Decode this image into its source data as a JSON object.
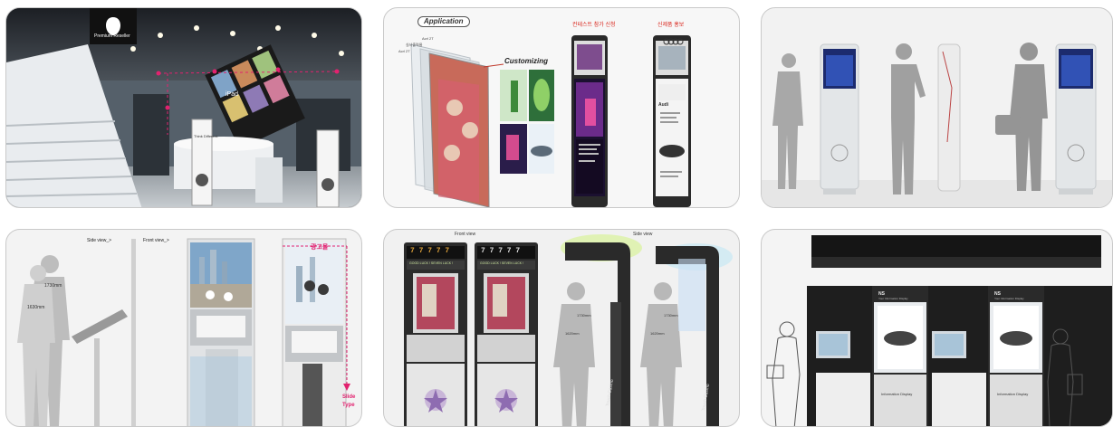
{
  "panels": {
    "store": {
      "reseller_label": "Premium Reseller",
      "ipad_label": "iPad",
      "think_label": "Think Different."
    },
    "application": {
      "title_badge": "Application",
      "customizing_label": "Customizing",
      "layer_labels": [
        "Acrl 2T",
        "실사출력물",
        "Acrl 2T"
      ],
      "heading_left": "컨테스트 참가 신청",
      "heading_right": "신제품 홍보",
      "audi_label": "Audi"
    },
    "kiosk_row": {},
    "dimensions": {
      "side_view_label": "Side view_>",
      "front_view_label": "Front view_>",
      "height_top": "1730mm",
      "height_bottom": "1630mm",
      "ad_tag": "광고물",
      "slide_label": "Slide",
      "type_label": "Type"
    },
    "casino": {
      "front_view_label": "Front view",
      "side_view_label": "Side view",
      "digits": "7 7 7 7 7",
      "banner_text": "GOOD LUCK ! SEVEN LUCK !",
      "height_top": "1730mm",
      "height_bottom": "1620mm",
      "brand_label": "Touch Casino"
    },
    "info_display": {
      "brand_line1": "NS",
      "brand_line2": "Your Information Display",
      "footer_label": "Information Display"
    }
  },
  "colors": {
    "pink_accent": "#e2226f",
    "heading_red": "#d9261c",
    "panel_border": "#c9c9c9"
  }
}
